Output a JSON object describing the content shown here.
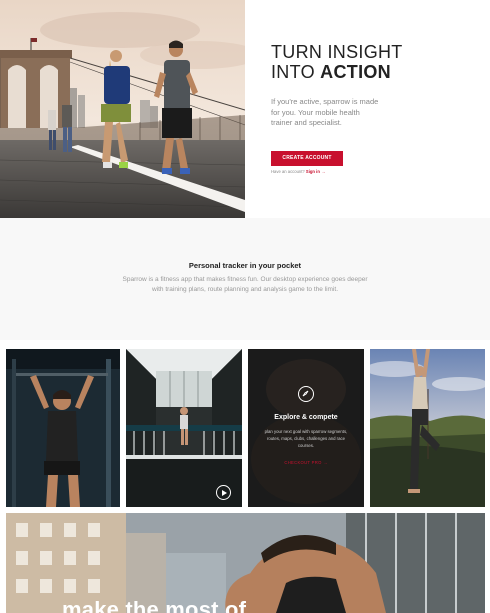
{
  "hero": {
    "title_line1": "TURN INSIGHT",
    "title_line2_a": "INTO ",
    "title_line2_b": "ACTION",
    "description": "If you're active, sparrow is made for you. Your mobile health trainer and specialist.",
    "cta_label": "CREATE ACCOUNT",
    "signin_prefix": "Have an account? ",
    "signin_link": "Sign in",
    "signin_arrow": "→"
  },
  "tracker": {
    "title": "Personal tracker in your pocket",
    "description": "Sparrow is a fitness app that makes fitness fun. Our desktop experience goes deeper with training plans, route planning and analysis game to the limit."
  },
  "tiles": {
    "explore": {
      "title": "Explore & compete",
      "description": "plan your next goal with sparrow segments, routes, maps, clubs, challenges and race courses.",
      "link": "CHECKOUT PRO →"
    }
  },
  "banner": {
    "headline": "make the most of"
  },
  "colors": {
    "accent": "#c8102e",
    "text_dark": "#222222",
    "text_muted": "#888888",
    "section_bg": "#f8f8f8"
  },
  "icons": {
    "compass": "compass-icon",
    "play": "play-icon",
    "arrow": "arrow-right-icon"
  }
}
